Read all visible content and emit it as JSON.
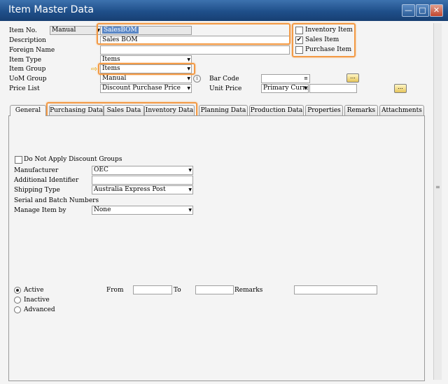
{
  "window": {
    "title": "Item Master Data"
  },
  "header": {
    "item_no_label": "Item No.",
    "series": "Manual",
    "item_no_value": "SalesBOM",
    "description_label": "Description",
    "description_value": "Sales BOM",
    "foreign_name_label": "Foreign Name",
    "item_type_label": "Item Type",
    "item_type_value": "Items",
    "item_group_label": "Item Group",
    "item_group_value": "Items",
    "uom_group_label": "UoM Group",
    "uom_group_value": "Manual",
    "price_list_label": "Price List",
    "price_list_value": "Discount Purchase Price",
    "bar_code_label": "Bar Code",
    "unit_price_label": "Unit Price",
    "unit_price_currency": "Primary Curre",
    "inventory_item_label": "Inventory Item",
    "sales_item_label": "Sales Item",
    "purchase_item_label": "Purchase Item",
    "info_icon": "i",
    "bar_code_suffix": "≡"
  },
  "checks": {
    "inventory_item": false,
    "sales_item": true,
    "purchase_item": false
  },
  "tabs": [
    {
      "label": "General"
    },
    {
      "label": "Purchasing Data"
    },
    {
      "label": "Sales Data"
    },
    {
      "label": "Inventory Data"
    },
    {
      "label": "Planning Data"
    },
    {
      "label": "Production Data"
    },
    {
      "label": "Properties"
    },
    {
      "label": "Remarks"
    },
    {
      "label": "Attachments"
    }
  ],
  "general": {
    "no_discount_label": "Do Not Apply Discount Groups",
    "manufacturer_label": "Manufacturer",
    "manufacturer_value": "OEC",
    "additional_id_label": "Additional Identifier",
    "shipping_type_label": "Shipping Type",
    "shipping_type_value": "Australia Express Post",
    "serial_batch_label": "Serial and Batch Numbers",
    "manage_by_label": "Manage Item by",
    "manage_by_value": "None",
    "active_label": "Active",
    "inactive_label": "Inactive",
    "advanced_label": "Advanced",
    "from_label": "From",
    "to_label": "To",
    "remarks_label": "Remarks"
  },
  "status": {
    "selected": "Active"
  },
  "colors": {
    "title_bar": "#1f4f8a",
    "highlight": "#f39a45",
    "selection": "#5a87c6"
  },
  "icons": {
    "link_arrow": "⇨",
    "choose_button": "...",
    "scroll_grip": "≡"
  }
}
